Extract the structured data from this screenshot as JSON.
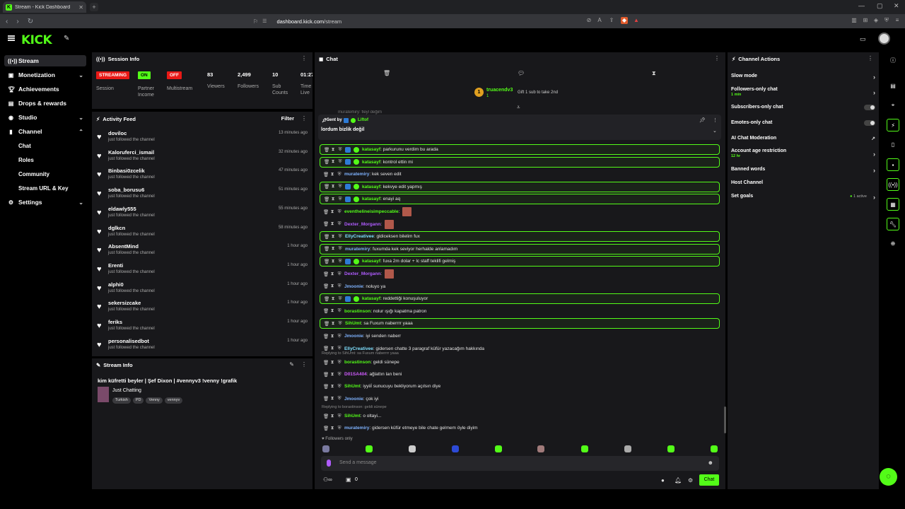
{
  "browser": {
    "tab_title": "Stream - Kick Dashboard",
    "url_host": "dashboard.kick.com",
    "url_path": "/stream"
  },
  "app": {
    "logo": "KICK"
  },
  "sidebar": {
    "items": [
      {
        "label": "Stream",
        "icon": "radio-icon"
      },
      {
        "label": "Monetization",
        "icon": "money-icon"
      },
      {
        "label": "Achievements",
        "icon": "trophy-icon"
      },
      {
        "label": "Drops & rewards",
        "icon": "gift-icon"
      },
      {
        "label": "Studio",
        "icon": "video-icon"
      },
      {
        "label": "Channel",
        "icon": "user-icon"
      },
      {
        "label": "Settings",
        "icon": "gear-icon"
      }
    ],
    "channel_sub": [
      "Chat",
      "Roles",
      "Community",
      "Stream URL & Key"
    ]
  },
  "session": {
    "title": "Session Info",
    "streaming_badge": "STREAMING",
    "session_label": "Session",
    "on_badge": "ON",
    "partner_label": "Partner Income",
    "off_badge": "OFF",
    "multistream_label": "Multistream",
    "viewers": "83",
    "viewers_label": "Viewers",
    "followers": "2,499",
    "followers_label": "Followers",
    "subs": "10",
    "subs_label": "Sub Counts",
    "time": "01:27",
    "time_label": "Time Live"
  },
  "activity": {
    "title": "Activity Feed",
    "filter": "Filter",
    "rows": [
      {
        "name": "doviloc",
        "event": "just followed the channel",
        "time": "13 minutes ago"
      },
      {
        "name": "Kaloruferci_ismail",
        "event": "just followed the channel",
        "time": "32 minutes ago"
      },
      {
        "name": "Binbasi0zcelik",
        "event": "just followed the channel",
        "time": "47 minutes ago"
      },
      {
        "name": "soba_borusu6",
        "event": "just followed the channel",
        "time": "51 minutes ago"
      },
      {
        "name": "eldawly555",
        "event": "just followed the channel",
        "time": "55 minutes ago"
      },
      {
        "name": "dglkcn",
        "event": "just followed the channel",
        "time": "58 minutes ago"
      },
      {
        "name": "AbsentMind",
        "event": "just followed the channel",
        "time": "1 hour ago"
      },
      {
        "name": "Erenti",
        "event": "just followed the channel",
        "time": "1 hour ago"
      },
      {
        "name": "alphi0",
        "event": "just followed the channel",
        "time": "1 hour ago"
      },
      {
        "name": "sekersizcake",
        "event": "just followed the channel",
        "time": "1 hour ago"
      },
      {
        "name": "feriks",
        "event": "just followed the channel",
        "time": "1 hour ago"
      },
      {
        "name": "personalisedbot",
        "event": "just followed the channel",
        "time": "1 hour ago"
      }
    ]
  },
  "stream_info": {
    "title": "Stream Info",
    "stream_title": "kim küfretti beyler | Şef Dixon | #vennyv3 !venny !grafik",
    "category": "Just Chatting",
    "tags": [
      "Turkish",
      "PD",
      "Venny",
      "vennyv"
    ]
  },
  "chat": {
    "title": "Chat",
    "gifter": "truacendv3",
    "gifter_count": "1",
    "gift_text": "Gift 1 sub to take 2nd",
    "pinned_prev": "muratemiry: fleyl değim",
    "pinned_sent_by": "Sent by",
    "pinned_user": "Liftof",
    "pinned_text": "lordum bizlik değil",
    "messages": [
      {
        "user": "katasayf",
        "text": "parkurunu verdim bu arada",
        "color": "#53fc18",
        "hl": true,
        "badges": true
      },
      {
        "user": "katasayf",
        "text": "kontrol ettin mi",
        "color": "#53fc18",
        "hl": true,
        "badges": true
      },
      {
        "user": "muratemiry",
        "text": "kek seven edit",
        "color": "#7fb3ff",
        "hl": false,
        "badges": false
      },
      {
        "user": "katasayf",
        "text": "kekvye edit yapmış",
        "color": "#53fc18",
        "hl": true,
        "badges": true
      },
      {
        "user": "katasayf",
        "text": "enayi aq",
        "color": "#53fc18",
        "hl": true,
        "badges": true
      },
      {
        "user": "eventhelineisimpeccable",
        "text": "",
        "color": "#53fc18",
        "hl": false,
        "badges": false,
        "emote": true
      },
      {
        "user": "Dexter_Morgann",
        "text": "",
        "color": "#b05cff",
        "hl": false,
        "badges": false,
        "emote": true
      },
      {
        "user": "EllyCreativee",
        "text": "gldiceksen bilelim fux",
        "color": "#7fe0ff",
        "hl": true,
        "badges": false
      },
      {
        "user": "muratemiry",
        "text": "fuxumda kek seviyor herhalde anlamadım",
        "color": "#7fb3ff",
        "hl": true,
        "badges": false
      },
      {
        "user": "katasayf",
        "text": "fuxa 2m dolar + lc staff teklifi gelmiş",
        "color": "#53fc18",
        "hl": true,
        "badges": true
      },
      {
        "user": "Dexter_Morgann",
        "text": "",
        "color": "#b05cff",
        "hl": false,
        "badges": false,
        "emote": true
      },
      {
        "user": "Jmoonie",
        "text": "noluyo ya",
        "color": "#7fb3ff",
        "hl": false,
        "badges": false
      },
      {
        "user": "katasayf",
        "text": "reddettiği konuşuluyor",
        "color": "#53fc18",
        "hl": true,
        "badges": true
      },
      {
        "user": "borastinson",
        "text": "nolur ışığı kapatma patron",
        "color": "#53fc18",
        "hl": false,
        "badges": false
      },
      {
        "user": "SihUmt",
        "text": "sa Fuxum naberrrr yaaa",
        "color": "#53fc18",
        "hl": true,
        "badges": false
      },
      {
        "user": "Jmoonie",
        "text": "iyi senden naberr",
        "color": "#7fb3ff",
        "hl": false,
        "badges": false
      },
      {
        "user": "EllyCreativee",
        "text": "gidersen chatte 3 paragraf küfür yazacağım hakkında",
        "color": "#7fe0ff",
        "hl": false,
        "badges": false
      }
    ],
    "reply1": "Replying to SihUmt: sa Fuxum naberrrr yaaa",
    "messages2": [
      {
        "user": "borastinson",
        "text": "geldi sünepe",
        "color": "#53fc18",
        "hl": false,
        "badges": false
      },
      {
        "user": "D01SA404",
        "text": "ağlattın lan beni",
        "color": "#d05cff",
        "hl": false,
        "badges": false
      },
      {
        "user": "SihUmt",
        "text": "iyyiiİ sunucuyu bekliyorum açılsın diye",
        "color": "#53fc18",
        "hl": false,
        "badges": false
      },
      {
        "user": "Jmoonie",
        "text": "çok iyi",
        "color": "#7fb3ff",
        "hl": false,
        "badges": false
      }
    ],
    "reply2": "Replying to borastinson: geldi sünepe",
    "messages3": [
      {
        "user": "SihUmt",
        "text": "o oltayi...",
        "color": "#53fc18",
        "hl": false,
        "badges": false
      },
      {
        "user": "muratemiry",
        "text": "gidersen küfür etmeye bile chate gelmem öyle diyim",
        "color": "#7fb3ff",
        "hl": false,
        "badges": false
      }
    ],
    "followers_only": "Followers only",
    "input_placeholder": "Send a message",
    "footer_count": "0",
    "chat_button": "Chat"
  },
  "channel_actions": {
    "title": "Channel Actions",
    "slow_mode": "Slow mode",
    "followers_only": "Followers-only chat",
    "followers_only_sub": "1 min",
    "subscribers_only": "Subscribers-only chat",
    "emotes_only": "Emotes-only chat",
    "ai_moderation": "AI Chat Moderation",
    "age_restriction": "Account age restriction",
    "age_restriction_sub": "12 hr",
    "banned_words": "Banned words",
    "host_channel": "Host Channel",
    "set_goals": "Set goals",
    "goals_active": "1 active"
  },
  "colors": {
    "accent": "#53fc18",
    "panel": "#18181b",
    "streaming": "#e91916"
  }
}
